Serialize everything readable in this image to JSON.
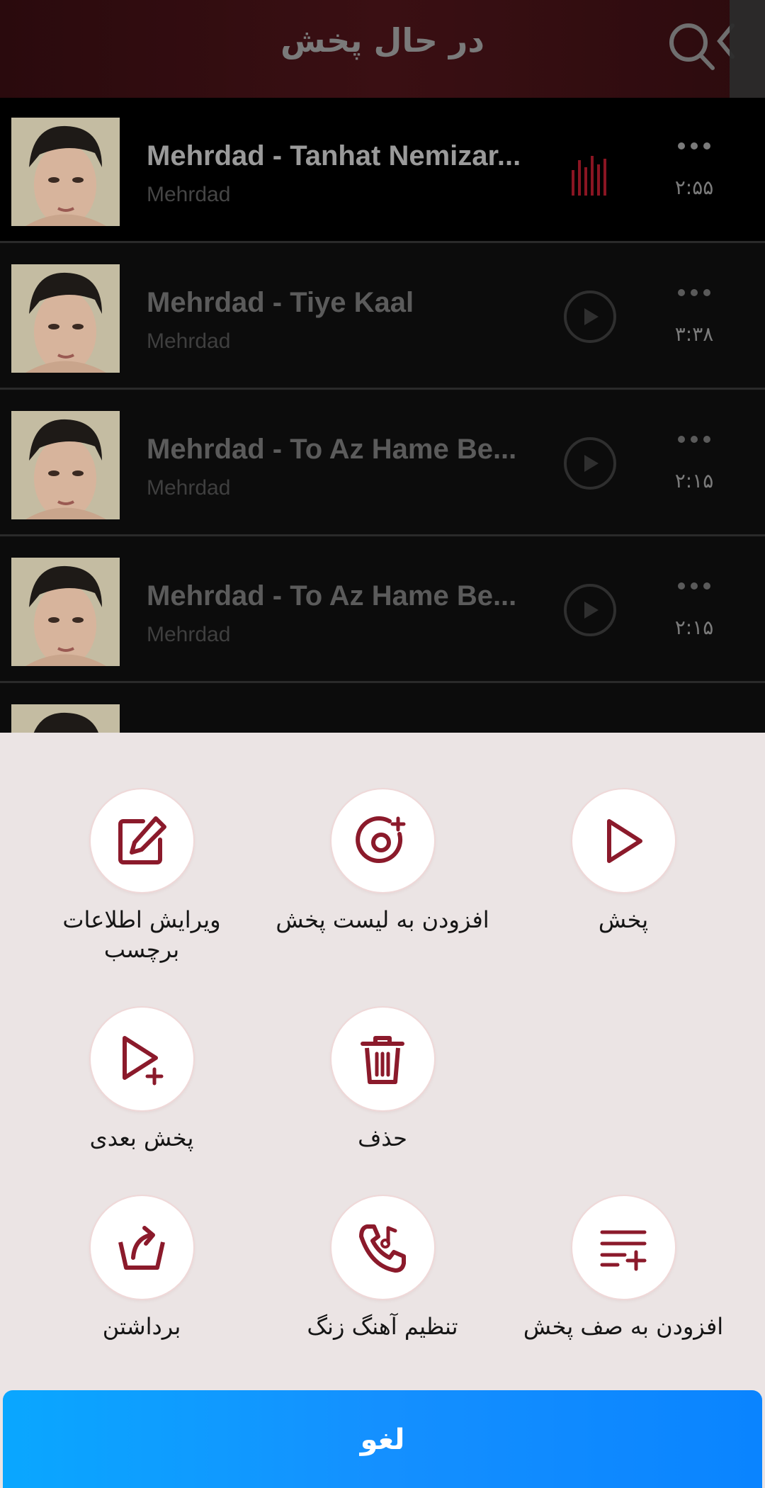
{
  "header": {
    "title": "در حال پخش"
  },
  "songs": [
    {
      "title": "Mehrdad - Tanhat Nemizar...",
      "artist": "Mehrdad",
      "duration": "۲:۵۵",
      "playing": true
    },
    {
      "title": "Mehrdad - Tiye Kaal",
      "artist": "Mehrdad",
      "duration": "۳:۳۸",
      "playing": false
    },
    {
      "title": "Mehrdad - To Az Hame Be...",
      "artist": "Mehrdad",
      "duration": "۲:۱۵",
      "playing": false
    },
    {
      "title": "Mehrdad - To Az Hame Be...",
      "artist": "Mehrdad",
      "duration": "۲:۱۵",
      "playing": false
    }
  ],
  "actions": {
    "play": "پخش",
    "add_to_playlist": "افزودن به لیست پخش",
    "edit_tag_line1": "ویرایش اطلاعات",
    "edit_tag_line2": "برچسب",
    "delete": "حذف",
    "play_next": "پخش بعدی",
    "add_to_queue": "افزودن به صف پخش",
    "set_ringtone": "تنظیم آهنگ زنگ",
    "share": "برداشتن"
  },
  "cancel_label": "لغو",
  "colors": {
    "accent": "#8b1a2b",
    "cancel_blue": "#0a94ff",
    "sheet_bg": "#ebe4e4"
  },
  "icons": {
    "search": "search-icon",
    "play": "play-icon",
    "more": "more-dots-icon",
    "equalizer": "equalizer-icon",
    "playlist_add": "playlist-add-icon",
    "edit": "edit-icon",
    "trash": "trash-icon",
    "play_next": "play-next-icon",
    "queue": "queue-add-icon",
    "ringtone": "ringtone-icon",
    "share": "share-icon"
  }
}
